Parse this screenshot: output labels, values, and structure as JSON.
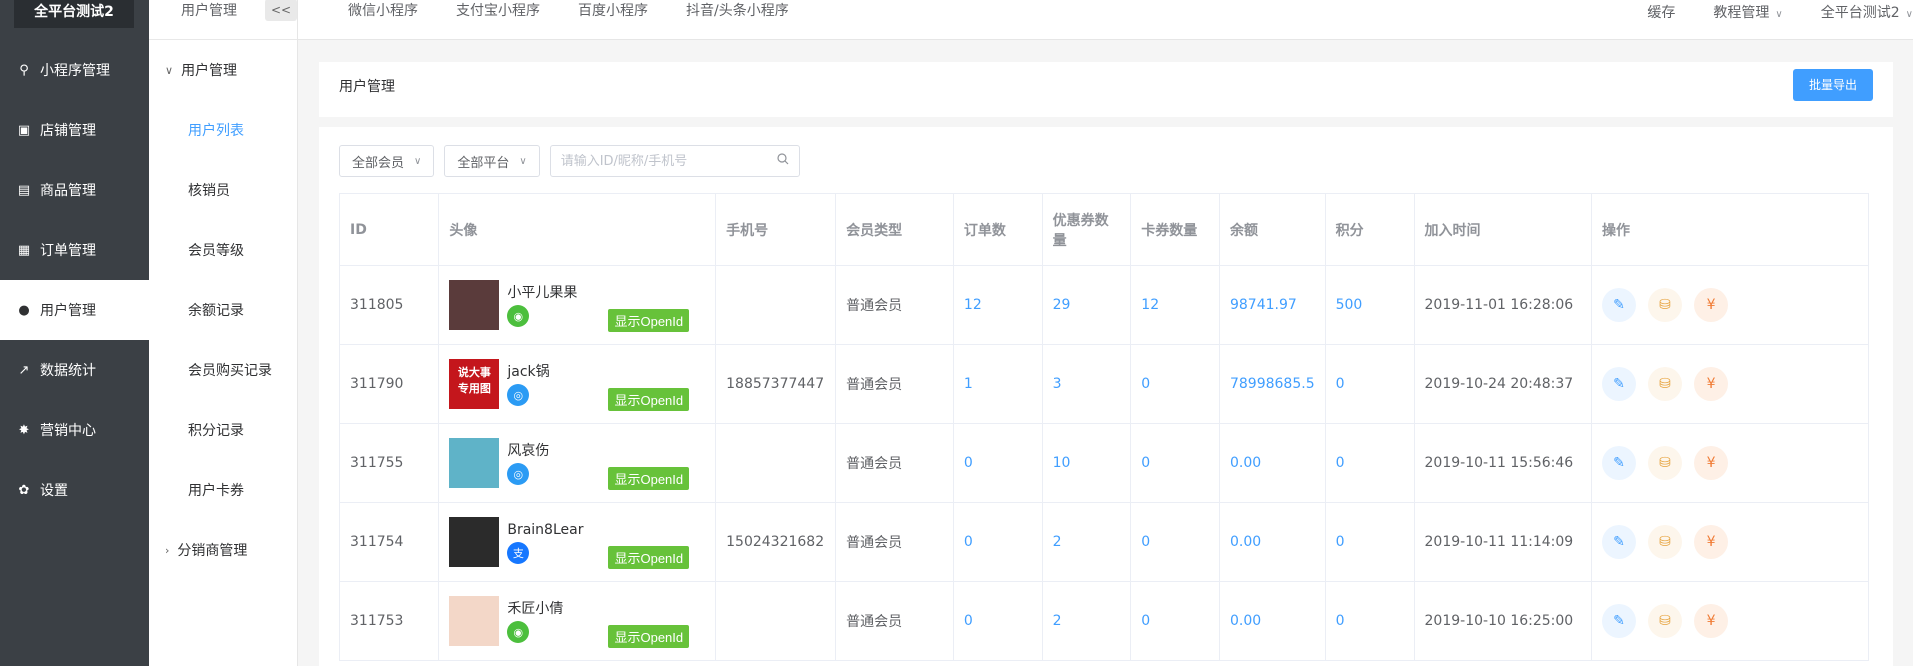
{
  "brand": "全平台测试2",
  "nav": [
    {
      "label": "小程序管理",
      "icon": "link-icon"
    },
    {
      "label": "店铺管理",
      "icon": "store-icon"
    },
    {
      "label": "商品管理",
      "icon": "goods-icon"
    },
    {
      "label": "订单管理",
      "icon": "order-icon"
    },
    {
      "label": "用户管理",
      "icon": "user-icon",
      "active": true
    },
    {
      "label": "数据统计",
      "icon": "chart-icon"
    },
    {
      "label": "营销中心",
      "icon": "marketing-icon"
    },
    {
      "label": "设置",
      "icon": "gear-icon"
    }
  ],
  "subbar": {
    "header": "用户管理",
    "collapse": "<<",
    "group": "用户管理",
    "items": [
      "用户列表",
      "核销员",
      "会员等级",
      "余额记录",
      "会员购买记录",
      "积分记录",
      "用户卡券"
    ],
    "group2": "分销商管理"
  },
  "topbar": {
    "tabs": [
      "微信小程序",
      "支付宝小程序",
      "百度小程序",
      "抖音/头条小程序"
    ],
    "right": [
      "缓存",
      "教程管理",
      "全平台测试2"
    ]
  },
  "panel": {
    "title": "用户管理",
    "export": "批量导出",
    "filter_member": "全部会员",
    "filter_platform": "全部平台",
    "search_placeholder": "请输入ID/昵称/手机号"
  },
  "table": {
    "headers": [
      "ID",
      "头像",
      "手机号",
      "会员类型",
      "订单数",
      "优惠券数量",
      "卡券数量",
      "余额",
      "积分",
      "加入时间",
      "操作"
    ],
    "openid_label": "显示OpenId",
    "rows": [
      {
        "id": "311805",
        "name": "小平儿果果",
        "platform": "wx",
        "phone": "",
        "type": "普通会员",
        "orders": "12",
        "coupons": "29",
        "cards": "12",
        "balance": "98741.97",
        "points": "500",
        "joined": "2019-11-01 16:28:06",
        "avatar_color": "#5a3b3b"
      },
      {
        "id": "311790",
        "name": "jack锅",
        "platform": "tt",
        "phone": "18857377447",
        "type": "普通会员",
        "orders": "1",
        "coupons": "3",
        "cards": "0",
        "balance": "78998685.5",
        "points": "0",
        "joined": "2019-10-24 20:48:37",
        "avatar_color": "#c4161c",
        "avatar_text": "说大事专用图"
      },
      {
        "id": "311755",
        "name": "风哀伤",
        "platform": "tt",
        "phone": "",
        "type": "普通会员",
        "orders": "0",
        "coupons": "10",
        "cards": "0",
        "balance": "0.00",
        "points": "0",
        "joined": "2019-10-11 15:56:46",
        "avatar_color": "#5fb3c8"
      },
      {
        "id": "311754",
        "name": "Brain8Lear",
        "platform": "ali",
        "phone": "15024321682",
        "type": "普通会员",
        "orders": "0",
        "coupons": "2",
        "cards": "0",
        "balance": "0.00",
        "points": "0",
        "joined": "2019-10-11 11:14:09",
        "avatar_color": "#2b2b2b"
      },
      {
        "id": "311753",
        "name": "禾匠小倩",
        "platform": "wx",
        "phone": "",
        "type": "普通会员",
        "orders": "0",
        "coupons": "2",
        "cards": "0",
        "balance": "0.00",
        "points": "0",
        "joined": "2019-10-10 16:25:00",
        "avatar_color": "#f3d7c8"
      }
    ]
  }
}
